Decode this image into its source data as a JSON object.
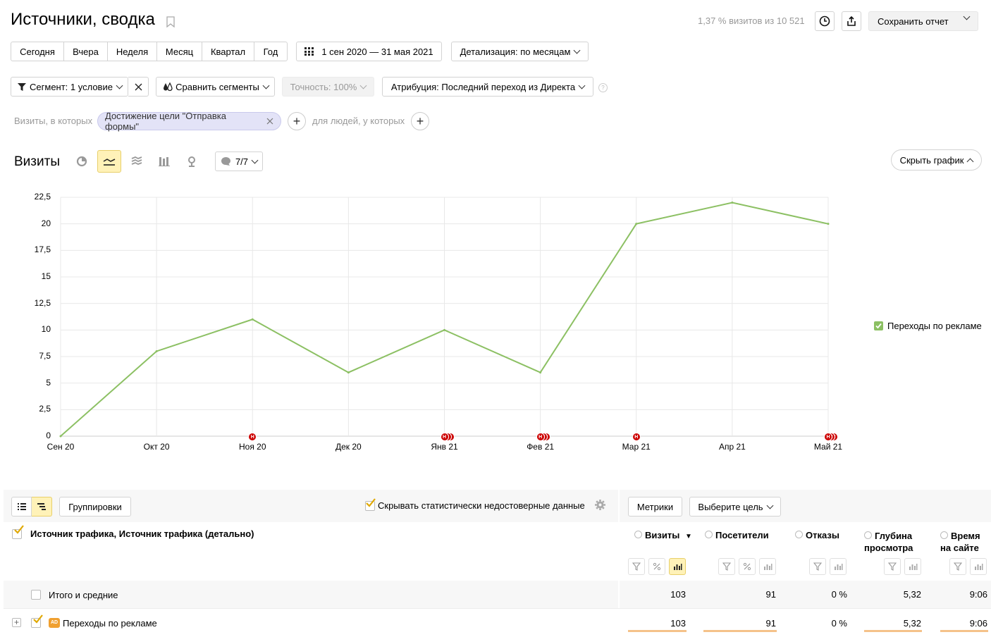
{
  "header": {
    "title": "Источники, сводка",
    "visits_info": "1,37 % визитов из 10 521",
    "save_report": "Сохранить отчет"
  },
  "periods": [
    "Сегодня",
    "Вчера",
    "Неделя",
    "Месяц",
    "Квартал",
    "Год"
  ],
  "date_range": "1 сен 2020 — 31 мая 2021",
  "detail": "Детализация: по месяцам",
  "segment": {
    "label": "Сегмент: 1 условие",
    "compare": "Сравнить сегменты",
    "accuracy": "Точность: 100%",
    "attribution": "Атрибуция: Последний переход из Директа"
  },
  "filter": {
    "visits_prefix": "Визиты, в которых",
    "chip": "Достижение цели \"Отправка формы\"",
    "people_prefix": "для людей, у которых"
  },
  "chart_panel": {
    "title": "Визиты",
    "annotations": "7/7",
    "hide_chart": "Скрыть график"
  },
  "chart_data": {
    "type": "line",
    "x": [
      "Сен 20",
      "Окт 20",
      "Ноя 20",
      "Дек 20",
      "Янв 21",
      "Фев 21",
      "Мар 21",
      "Апр 21",
      "Май 21"
    ],
    "yticks": [
      "0",
      "2,5",
      "5",
      "7,5",
      "10",
      "12,5",
      "15",
      "17,5",
      "20",
      "22,5"
    ],
    "ylim": [
      0,
      22.5
    ],
    "series": [
      {
        "name": "Переходы по рекламе",
        "color": "#8cc063",
        "values": [
          0,
          8,
          11,
          6,
          10,
          6,
          20,
          22,
          20
        ]
      }
    ],
    "event_markers": [
      {
        "month": "Ноя 20",
        "count": 1,
        "label": "Н"
      },
      {
        "month": "Янв 21",
        "count": 3,
        "label": "Н"
      },
      {
        "month": "Фев 21",
        "count": 3,
        "label": "Н"
      },
      {
        "month": "Мар 21",
        "count": 1,
        "label": "Н"
      },
      {
        "month": "Май 21",
        "count": 3,
        "label": "Н"
      }
    ],
    "legend_position": "right",
    "grid": true
  },
  "table_toolbar": {
    "groupings": "Группировки",
    "hide_unreliable": "Скрывать статистически недостоверные данные",
    "metrics": "Метрики",
    "choose_goal": "Выберите цель"
  },
  "table": {
    "dimension_header": "Источник трафика, Источник трафика (детально)",
    "columns": [
      {
        "label": "Визиты",
        "sort": "▼"
      },
      {
        "label": "Посетители"
      },
      {
        "label": "Отказы"
      },
      {
        "label": "Глубина",
        "label2": "просмотра"
      },
      {
        "label": "Время",
        "label2": "на сайте"
      }
    ],
    "rows": [
      {
        "name": "Итого и средние",
        "values": [
          "103",
          "91",
          "0 %",
          "5,32",
          "9:06"
        ]
      },
      {
        "name": "Переходы по рекламе",
        "badge": "AD",
        "values": [
          "103",
          "91",
          "0 %",
          "5,32",
          "9:06"
        ]
      }
    ]
  },
  "colors": {
    "accent_yellow": "#fff2b8",
    "line_green": "#8cc063",
    "event_red": "#cc0000",
    "bar_orange": "#f5c28a"
  }
}
